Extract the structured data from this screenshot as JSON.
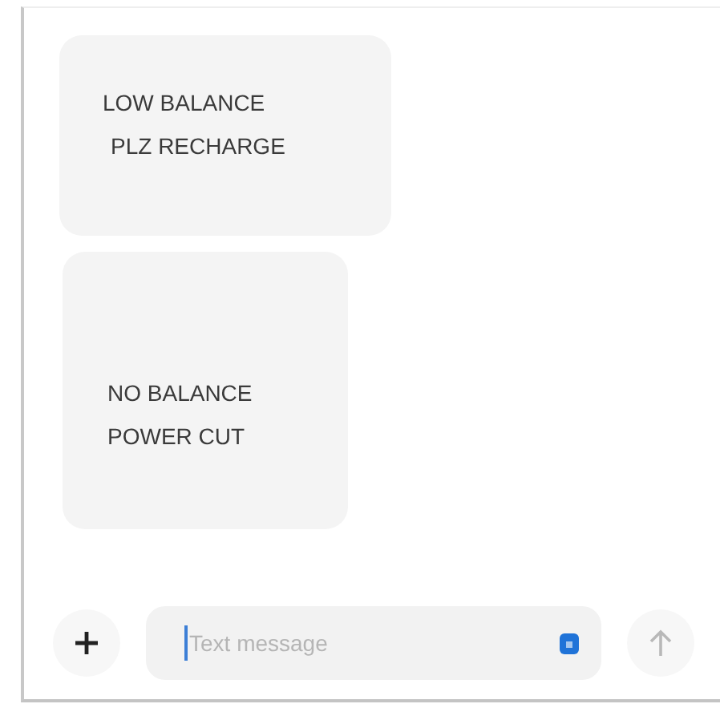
{
  "messages": [
    {
      "lines": [
        "LOW BALANCE",
        "PLZ RECHARGE"
      ]
    },
    {
      "lines": [
        "NO BALANCE",
        "POWER CUT"
      ]
    }
  ],
  "composer": {
    "placeholder": "Text message"
  }
}
